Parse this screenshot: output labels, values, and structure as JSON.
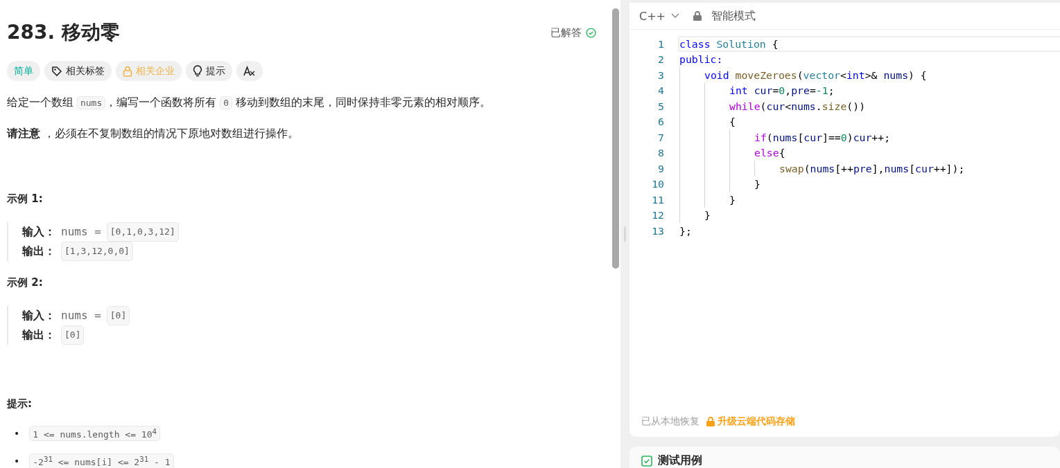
{
  "problem": {
    "title": "283. 移动零",
    "status": "已解答",
    "solved": true,
    "tags": [
      {
        "kind": "difficulty",
        "label": "简单"
      },
      {
        "kind": "tag",
        "label": "相关标签"
      },
      {
        "kind": "locked",
        "label": "相关企业"
      },
      {
        "kind": "hint",
        "label": "提示"
      },
      {
        "kind": "translate"
      }
    ],
    "paragraphs": [
      [
        {
          "kind": "text",
          "text": "给定一个数组 "
        },
        {
          "kind": "code",
          "text": "nums"
        },
        {
          "kind": "text",
          "text": "，编写一个函数将所有 "
        },
        {
          "kind": "code",
          "text": "0"
        },
        {
          "kind": "text",
          "text": " 移动到数组的末尾，同时保持非零元素的相对顺序。"
        }
      ],
      [
        {
          "kind": "text",
          "text": "**请注意** ，必须在不复制数组的情况下原地对数组进行操作。"
        }
      ]
    ],
    "examples": [
      {
        "title": "示例 1:",
        "input_label": "输入：",
        "input_name": "nums =",
        "input": "[0,1,0,3,12]",
        "output_label": "输出：",
        "output": "[1,3,12,0,0]"
      },
      {
        "title": "示例 2:",
        "input_label": "输入：",
        "input_name": "nums =",
        "input": "[0]",
        "output_label": "输出：",
        "output": "[0]"
      }
    ],
    "constraints_title": "提示:",
    "constraints": [
      {
        "marker": "•",
        "text": "1 <= nums.length <= 10$^{4}$"
      },
      {
        "marker": "•",
        "text": "-2$^{31}$ <= nums[i] <= 2$^{31}$ - 1"
      }
    ]
  },
  "editor": {
    "language": "C++",
    "mode": "智能模式",
    "lines": [
      {
        "n": "1",
        "selected": true,
        "tokens": [
          {
            "kind": "kw",
            "text": "class"
          },
          {
            "kind": "type",
            "text": " Solution"
          },
          {
            "kind": "p",
            "text": " {"
          }
        ]
      },
      {
        "n": "2",
        "selected": false,
        "tokens": [
          {
            "kind": "kw",
            "text": "public:"
          }
        ],
        "children": [
          {
            "n": "3",
            "selected": false,
            "tokens": [
              {
                "kind": "kw",
                "text": "void"
              },
              {
                "kind": "fn",
                "text": " moveZeroes"
              },
              {
                "kind": "p",
                "text": "("
              },
              {
                "kind": "type",
                "text": "vector"
              },
              {
                "kind": "p",
                "text": "<"
              },
              {
                "kind": "kw",
                "text": "int"
              },
              {
                "kind": "p",
                "text": ">&"
              },
              {
                "kind": "var",
                "text": " nums"
              },
              {
                "kind": "p",
                "text": ") {"
              }
            ],
            "children": [
              {
                "n": "4",
                "selected": false,
                "tokens": [
                  {
                    "kind": "kw",
                    "text": "int"
                  },
                  {
                    "kind": "var",
                    "text": " cur"
                  },
                  {
                    "kind": "p",
                    "text": "="
                  },
                  {
                    "kind": "num",
                    "text": "0"
                  },
                  {
                    "kind": "p",
                    "text": ","
                  },
                  {
                    "kind": "var",
                    "text": "pre"
                  },
                  {
                    "kind": "p",
                    "text": "="
                  },
                  {
                    "kind": "num",
                    "text": "-1"
                  },
                  {
                    "kind": "p",
                    "text": ";"
                  }
                ]
              },
              {
                "n": "5",
                "selected": false,
                "tokens": [
                  {
                    "kind": "ctl",
                    "text": "while"
                  },
                  {
                    "kind": "p",
                    "text": "("
                  },
                  {
                    "kind": "var",
                    "text": "cur"
                  },
                  {
                    "kind": "p",
                    "text": "<"
                  },
                  {
                    "kind": "var",
                    "text": "nums"
                  },
                  {
                    "kind": "p",
                    "text": "."
                  },
                  {
                    "kind": "fn",
                    "text": "size"
                  },
                  {
                    "kind": "p",
                    "text": "())"
                  }
                ]
              },
              {
                "n": "6",
                "selected": false,
                "tokens": [
                  {
                    "kind": "p",
                    "text": "{"
                  }
                ],
                "children": [
                  {
                    "n": "7",
                    "selected": false,
                    "tokens": [
                      {
                        "kind": "ctl",
                        "text": "if"
                      },
                      {
                        "kind": "p",
                        "text": "("
                      },
                      {
                        "kind": "var",
                        "text": "nums"
                      },
                      {
                        "kind": "p",
                        "text": "["
                      },
                      {
                        "kind": "var",
                        "text": "cur"
                      },
                      {
                        "kind": "p",
                        "text": "]=="
                      },
                      {
                        "kind": "num",
                        "text": "0"
                      },
                      {
                        "kind": "p",
                        "text": ")"
                      },
                      {
                        "kind": "var",
                        "text": "cur"
                      },
                      {
                        "kind": "p",
                        "text": "++;"
                      }
                    ]
                  },
                  {
                    "n": "8",
                    "selected": false,
                    "tokens": [
                      {
                        "kind": "ctl",
                        "text": "else"
                      },
                      {
                        "kind": "p",
                        "text": "{"
                      }
                    ],
                    "children": [
                      {
                        "n": "9",
                        "selected": false,
                        "tokens": [
                          {
                            "kind": "fn",
                            "text": "swap"
                          },
                          {
                            "kind": "p",
                            "text": "("
                          },
                          {
                            "kind": "var",
                            "text": "nums"
                          },
                          {
                            "kind": "p",
                            "text": "[++"
                          },
                          {
                            "kind": "var",
                            "text": "pre"
                          },
                          {
                            "kind": "p",
                            "text": "],"
                          },
                          {
                            "kind": "var",
                            "text": "nums"
                          },
                          {
                            "kind": "p",
                            "text": "["
                          },
                          {
                            "kind": "var",
                            "text": "cur"
                          },
                          {
                            "kind": "p",
                            "text": "++]);"
                          }
                        ]
                      }
                    ]
                  },
                  {
                    "n": "10",
                    "selected": false,
                    "tokens": [
                      {
                        "kind": "p",
                        "text": "}"
                      }
                    ]
                  }
                ]
              },
              {
                "n": "11",
                "selected": false,
                "tokens": [
                  {
                    "kind": "p",
                    "text": "}"
                  }
                ]
              }
            ]
          },
          {
            "n": "12",
            "selected": false,
            "tokens": [
              {
                "kind": "p",
                "text": "}"
              }
            ]
          }
        ]
      },
      {
        "n": "13",
        "selected": false,
        "tokens": [
          {
            "kind": "p",
            "text": "};"
          }
        ]
      }
    ],
    "restore_note": "已从本地恢复",
    "upgrade_link": "升级云端代码存储"
  },
  "testcase": {
    "title": "测试用例"
  }
}
